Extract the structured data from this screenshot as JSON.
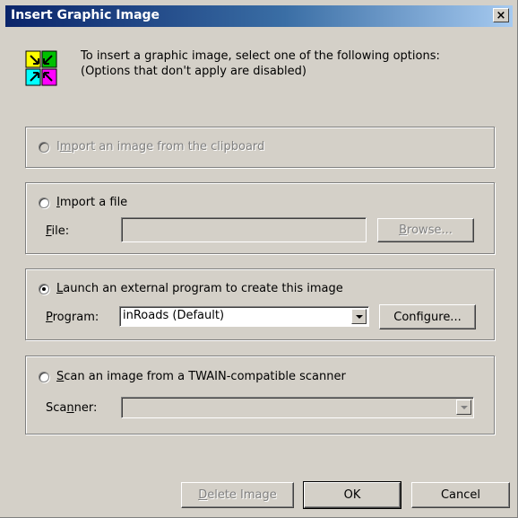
{
  "window": {
    "title": "Insert Graphic Image",
    "close_glyph": "×"
  },
  "intro": {
    "line1": "To insert a graphic image, select one of the following options:",
    "line2": "(Options that don't apply are disabled)",
    "icon": "insert-graphic-icon"
  },
  "clipboard_option": {
    "label_pre": "I",
    "label_accel": "m",
    "label_post": "port an image from the clipboard",
    "selected": false,
    "enabled": false
  },
  "file_option": {
    "label_accel": "I",
    "label_post": "mport a file",
    "selected": false,
    "field_label_accel": "F",
    "field_label_post": "ile:",
    "file_value": "",
    "browse_accel": "B",
    "browse_post": "rowse..."
  },
  "program_option": {
    "label_accel": "L",
    "label_post": "aunch an external program to create this image",
    "selected": true,
    "field_label_accel": "P",
    "field_label_post": "rogram:",
    "program_value": "inRoads (Default)",
    "configure_pre": "Confi",
    "configure_accel": "g",
    "configure_post": "ure..."
  },
  "scanner_option": {
    "label_accel": "S",
    "label_post": "can an image from a TWAIN-compatible scanner",
    "selected": false,
    "field_label_pre": "Sca",
    "field_label_accel": "n",
    "field_label_post": "ner:",
    "scanner_value": ""
  },
  "footer": {
    "delete_accel": "D",
    "delete_post": "elete Image",
    "ok_label": "OK",
    "cancel_label": "Cancel"
  }
}
